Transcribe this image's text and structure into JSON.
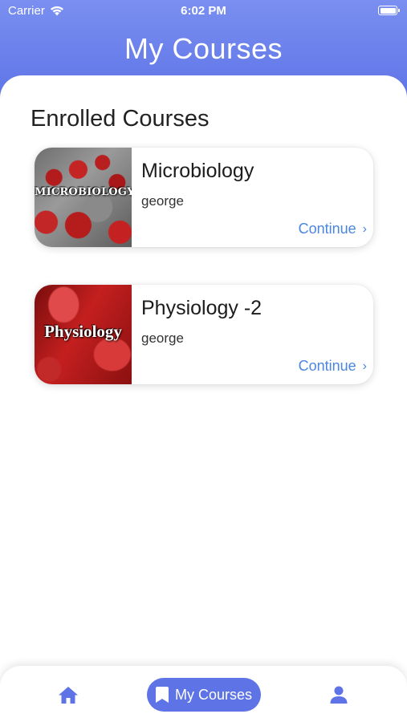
{
  "status": {
    "carrier": "Carrier",
    "time": "6:02 PM"
  },
  "header": {
    "title": "My Courses"
  },
  "section": {
    "title": "Enrolled Courses"
  },
  "courses": [
    {
      "title": "Microbiology",
      "author": "george",
      "thumb_text": "MICROBIOLOGY",
      "action": "Continue"
    },
    {
      "title": "Physiology -2",
      "author": "george",
      "thumb_text": "Physiology",
      "action": "Continue"
    }
  ],
  "tabbar": {
    "active_label": "My Courses",
    "icons": [
      "home-icon",
      "bookmark-icon",
      "person-icon"
    ]
  },
  "colors": {
    "accent": "#5d73e6",
    "link": "#4a86e0"
  }
}
